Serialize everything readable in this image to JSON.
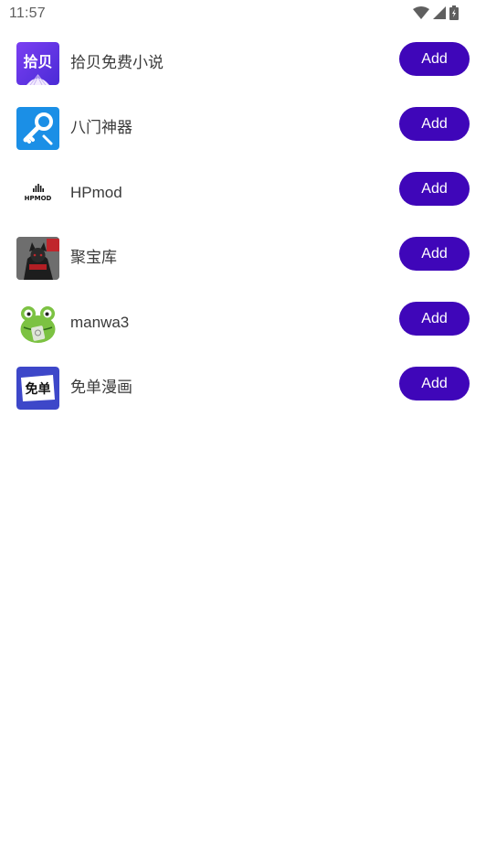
{
  "status_bar": {
    "time": "11:57",
    "icons": [
      "wifi-icon",
      "cell-signal-icon",
      "battery-charging-icon"
    ]
  },
  "apps": [
    {
      "name": "拾贝免费小说",
      "icon": "shibei-app-icon",
      "icon_text": "拾贝",
      "button_label": "Add"
    },
    {
      "name": "八门神器",
      "icon": "bamen-key-app-icon",
      "button_label": "Add"
    },
    {
      "name": "HPmod",
      "icon": "hpmod-app-icon",
      "icon_text": "HPMOD",
      "button_label": "Add"
    },
    {
      "name": "聚宝库",
      "icon": "jubaoku-app-icon",
      "button_label": "Add"
    },
    {
      "name": "manwa3",
      "icon": "frog-app-icon",
      "button_label": "Add"
    },
    {
      "name": "免单漫画",
      "icon": "miandan-app-icon",
      "icon_text": "免单",
      "button_label": "Add"
    }
  ],
  "colors": {
    "button_bg": "#3f06b9",
    "button_text": "#ffffff",
    "app_name_text": "#3a3a3a"
  }
}
